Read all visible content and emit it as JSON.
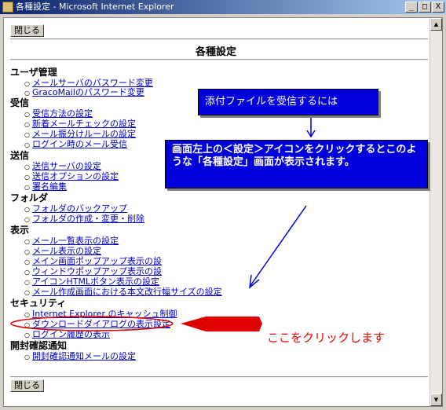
{
  "window": {
    "title": "各種設定 - Microsoft Internet Explorer",
    "minimize": "_",
    "maximize": "□",
    "close": "X"
  },
  "page": {
    "close_top": "閉じる",
    "close_bottom": "閉じる",
    "title": "各種設定"
  },
  "sections": [
    {
      "label": "ユーザ管理",
      "items": [
        "メールサーバのパスワード変更",
        "GracoMailのパスワード変更"
      ]
    },
    {
      "label": "受信",
      "items": [
        "受信方法の設定",
        "新着メールチェックの設定",
        "メール振分けルールの設定",
        "ログイン時のメール受信"
      ]
    },
    {
      "label": "送信",
      "items": [
        "送信サーバの設定",
        "送信オプションの設定",
        "署名編集"
      ]
    },
    {
      "label": "フォルダ",
      "items": [
        "フォルダのバックアップ",
        "フォルダの作成・変更・削除"
      ]
    },
    {
      "label": "表示",
      "items": [
        "メール一覧表示の設定",
        "メール表示の設定",
        "メイン画面ポップアップ表示の設",
        "ウィンドウポップアップ表示の設",
        "アイコンHTMLボタン表示の設定",
        "メール作成画面における本文改行幅サイズの設定"
      ]
    },
    {
      "label": "セキュリティ",
      "items": [
        "Internet Explorer のキャッシュ制御",
        "ダウンロードダイアログの表示設定",
        "ログイン履歴の表示"
      ]
    },
    {
      "label": "開封確認通知",
      "items": [
        "開封確認通知メールの設定"
      ]
    }
  ],
  "annotations": {
    "callout1": "添付ファイルを受信するには",
    "callout2": "画面左上の＜設定＞アイコンをクリックするとこのような「各種設定」画面が表示されます。",
    "hint": "ここをクリックします"
  },
  "colors": {
    "callout_bg": "#0000dd",
    "link": "#0000cc",
    "hint": "#ee0000"
  }
}
